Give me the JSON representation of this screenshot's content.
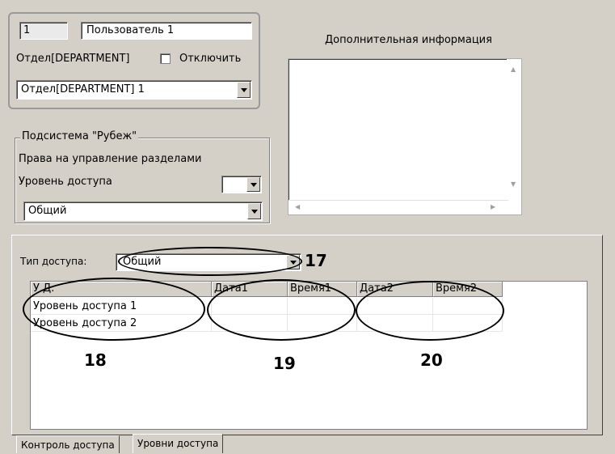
{
  "user_panel": {
    "id_value": "1",
    "name_value": "Пользователь 1",
    "department_label": "Отдел[DEPARTMENT]",
    "disable_label": "Отключить",
    "department_selected": "Отдел[DEPARTMENT] 1"
  },
  "additional_info": {
    "label": "Дополнительная информация"
  },
  "subsystem": {
    "legend": "Подсистема \"Рубеж\"",
    "rights_label": "Права на управление разделами",
    "access_level_label": "Уровень доступа",
    "access_level_value": "",
    "selected_value": "Общий"
  },
  "access": {
    "type_label": "Тип доступа:",
    "type_selected": "Общий",
    "columns": [
      "У.Д.",
      "Дата1",
      "Время1",
      "Дата2",
      "Время2"
    ],
    "rows": [
      [
        "Уровень доступа 1",
        "",
        "",
        "",
        ""
      ],
      [
        "Уровень доступа 2",
        "",
        "",
        "",
        ""
      ]
    ]
  },
  "annotations": {
    "n17": "17",
    "n18": "18",
    "n19": "19",
    "n20": "20"
  },
  "tabs": [
    "Контроль доступа",
    "Уровни доступа"
  ]
}
